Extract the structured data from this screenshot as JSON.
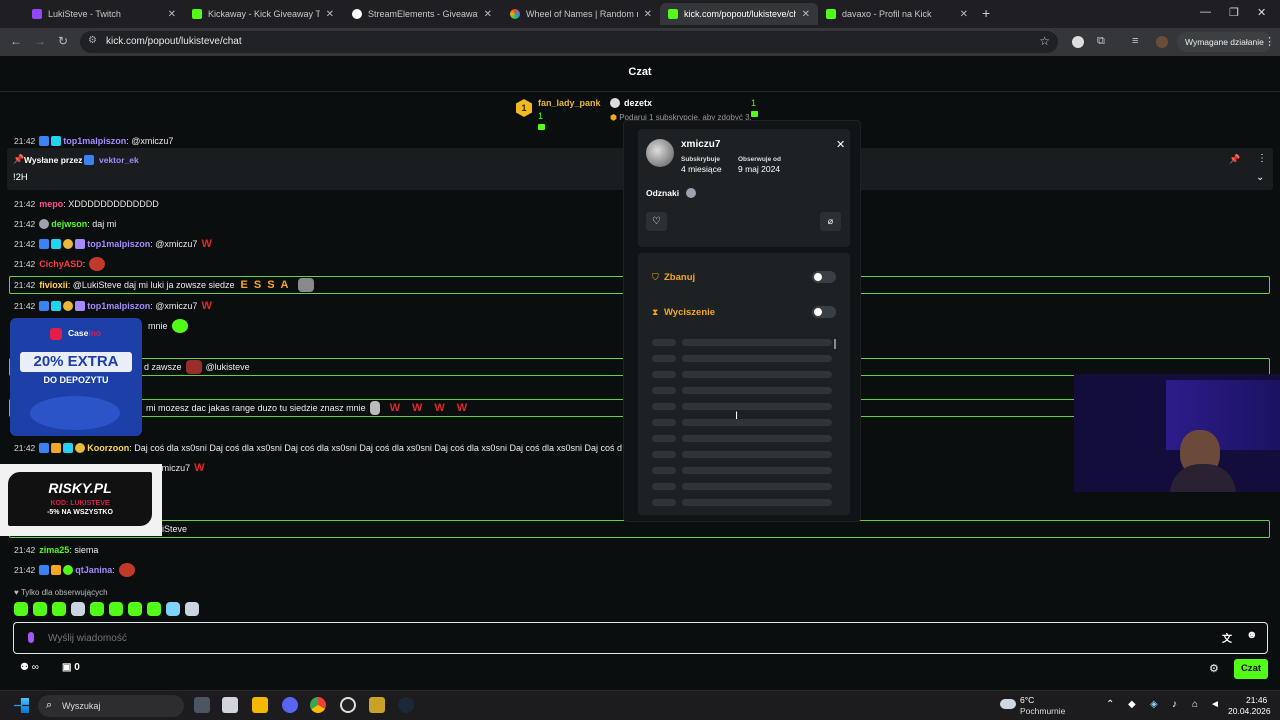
{
  "browser": {
    "tabs": [
      {
        "title": "LukiSteve - Twitch",
        "color": "#9146ff"
      },
      {
        "title": "Kickaway - Kick Giveaway Tool",
        "color": "#53fc18"
      },
      {
        "title": "StreamElements - Giveaways",
        "color": "#ffffff"
      },
      {
        "title": "Wheel of Names | Random nam",
        "color": "#e44d26"
      },
      {
        "title": "kick.com/popout/lukisteve/chat",
        "color": "#53fc18"
      },
      {
        "title": "davaxo - Profil na Kick",
        "color": "#53fc18"
      }
    ],
    "url": "kick.com/popout/lukisteve/chat",
    "required_action": "Wymagane działanie"
  },
  "header": {
    "title": "Czat"
  },
  "leaderboard": {
    "first": {
      "rank": "1",
      "name": "fan_lady_pank",
      "count": "1"
    },
    "second": {
      "name": "dezetx",
      "count": "1",
      "note": "Podaruj 1 subskrypcje, aby zdobyć 3."
    }
  },
  "pinned": {
    "label": "Wysłane przez",
    "user": "vektor_ek",
    "message": "!2H"
  },
  "chat": [
    {
      "time": "21:42",
      "user": "mepo",
      "color": "#ff4f8b",
      "text": ": XDDDDDDDDDDDDD"
    },
    {
      "time": "21:42",
      "user": "dejwson",
      "color": "#53fc18",
      "text": ": daj mi"
    },
    {
      "time": "21:42",
      "user": "top1malpiszon",
      "color": "#a68bff",
      "text": ": @xmiczu7"
    },
    {
      "time": "21:42",
      "user": "CichyASD",
      "color": "#ff3b3b",
      "text": ":"
    },
    {
      "time": "21:42",
      "user": "fivioxii",
      "color": "#ffd34d",
      "text": ": @LukiSteve daj mi luki ja zowsze siedze"
    },
    {
      "time": "21:42",
      "user": "top1malpiszon",
      "color": "#a68bff",
      "text": ": @xmiczu7"
    },
    {
      "time": "",
      "user": "",
      "color": "#ffffff",
      "text": "mnie"
    },
    {
      "time": "",
      "user": "",
      "color": "#ffffff",
      "text": "d zawsze"
    },
    {
      "time": "",
      "user": "",
      "color": "#ffffff",
      "text": "@lukisteve"
    },
    {
      "time": "",
      "user": "",
      "color": "#ffffff",
      "text": "mi mozesz dac jakas range duzo tu siedzie znasz mnie"
    },
    {
      "time": "21:42",
      "user": "Koorzoon",
      "color": "#ffd34d",
      "text": ": Daj coś dla xs0sni Daj coś dla xs0sni Daj coś dla xs0sni Daj coś dla xs0sni Daj coś dla xs0sni Daj coś dla xs0sni Daj coś d"
    },
    {
      "time": "",
      "user": "",
      "color": "#ffffff",
      "text": "@xmiczu7"
    },
    {
      "time": "",
      "user": "",
      "color": "#ffffff",
      "text": "iSteve"
    },
    {
      "time": "21:42",
      "user": "zima25",
      "color": "#53fc18",
      "text": ": siema"
    },
    {
      "time": "21:42",
      "user": "qtJanina",
      "color": "#a68bff",
      "text": ":"
    }
  ],
  "essa": "ESSA",
  "ads": {
    "casebrand": "Case",
    "casebrand2": "ino",
    "extra": "20% EXTRA",
    "deposit": "DO DEPOZYTU",
    "risky": "RISKY.PL",
    "risky_code": "KOD: LUKISTEVE",
    "risky_discount": "-5% NA WSZYSTKO"
  },
  "user_card": {
    "username": "xmiczu7",
    "sub_label": "Subskrybuje",
    "sub_value": "4 miesiące",
    "follow_label": "Obserwuje od",
    "follow_value": "9 maj 2024",
    "badges_label": "Odznaki",
    "ban_label": "Zbanuj",
    "mute_label": "Wyciszenie"
  },
  "footer": {
    "followers_only": "Tylko dla obserwujących",
    "placeholder": "Wyślij wiadomość",
    "count": "0",
    "send": "Czat"
  },
  "taskbar": {
    "search": "Wyszukaj",
    "temp": "6°C",
    "weather": "Pochmurnie",
    "time": "21:46",
    "date": "20.04.2026"
  },
  "colors": {
    "kick_green": "#53fc18",
    "accent_orange": "#f5a623"
  }
}
